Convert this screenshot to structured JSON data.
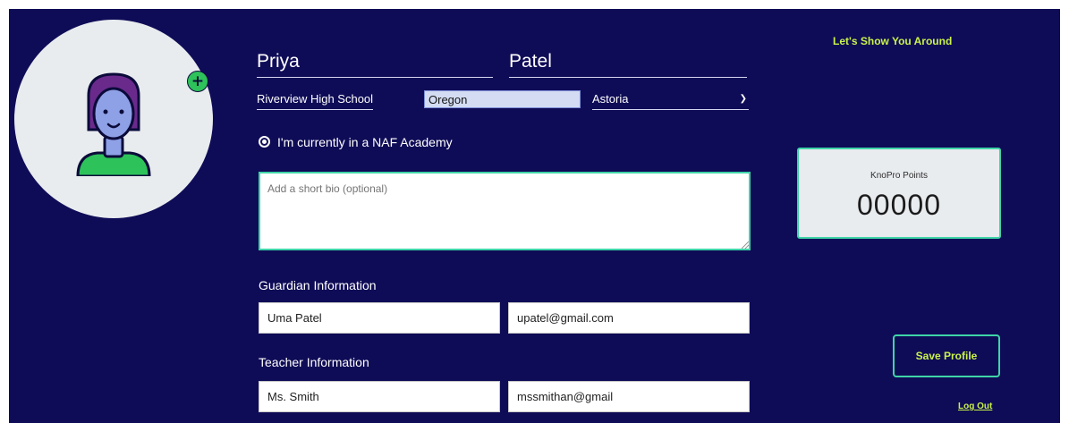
{
  "profile": {
    "first_name": "Priya",
    "last_name": "Patel",
    "school": "Riverview High School",
    "state": "Oregon",
    "city": "Astoria",
    "naf_label": "I'm currently in a NAF Academy",
    "bio_placeholder": "Add a short bio (optional)"
  },
  "guardian": {
    "section_label": "Guardian Information",
    "name": "Uma Patel",
    "email": "upatel@gmail.com"
  },
  "teacher": {
    "section_label": "Teacher Information",
    "name": "Ms. Smith",
    "email": "mssmithan@gmail"
  },
  "sidebar": {
    "tour_link": "Let's Show You Around",
    "points_label": "KnoPro Points",
    "points_value": "00000",
    "save_label": "Save Profile",
    "logout_label": "Log Out"
  },
  "icons": {
    "add_photo": "plus-icon",
    "city_dropdown": "chevron-down-icon",
    "avatar": "student-avatar-icon"
  },
  "colors": {
    "background": "#0f0c57",
    "accent": "#3fd4a8",
    "link": "#c8f34a",
    "add_button": "#2ec25a"
  }
}
